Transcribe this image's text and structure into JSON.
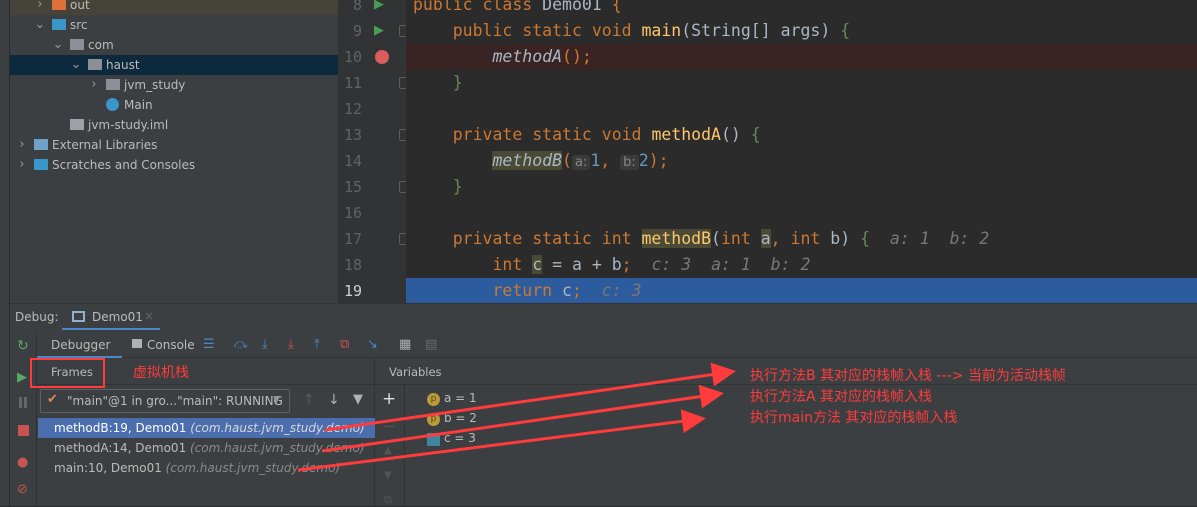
{
  "project_tree": [
    {
      "label": "out",
      "depth": 1,
      "expanded": false,
      "icon": "folder-orange-icon"
    },
    {
      "label": "src",
      "depth": 1,
      "expanded": true,
      "icon": "source-folder-icon"
    },
    {
      "label": "com",
      "depth": 2,
      "expanded": true,
      "icon": "package-icon"
    },
    {
      "label": "haust",
      "depth": 3,
      "expanded": true,
      "icon": "package-icon",
      "selected": true
    },
    {
      "label": "jvm_study",
      "depth": 4,
      "expanded": false,
      "icon": "package-icon"
    },
    {
      "label": "Main",
      "depth": 4,
      "icon": "java-class-icon"
    },
    {
      "label": "jvm-study.iml",
      "depth": 2,
      "icon": "iml-file-icon"
    },
    {
      "label": "External Libraries",
      "depth": 0,
      "expanded": false,
      "icon": "libraries-icon"
    },
    {
      "label": "Scratches and Consoles",
      "depth": 0,
      "expanded": false,
      "icon": "scratches-icon"
    }
  ],
  "editor": {
    "lines": [
      {
        "n": "8",
        "tokens": [
          [
            "kw",
            "public class "
          ],
          [
            "id",
            "Demo01 "
          ],
          [
            "br",
            "{"
          ]
        ]
      },
      {
        "n": "9",
        "tokens": [
          [
            "id",
            "    "
          ],
          [
            "kw",
            "public static void "
          ],
          [
            "fn",
            "main"
          ],
          [
            "id",
            "(String[] args) "
          ],
          [
            "grn",
            "{"
          ]
        ]
      },
      {
        "n": "10",
        "tokens": [
          [
            "id",
            "        "
          ],
          [
            "it",
            "methodA"
          ],
          [
            "br",
            "();"
          ]
        ]
      },
      {
        "n": "11",
        "tokens": [
          [
            "grn",
            "    }"
          ]
        ]
      },
      {
        "n": "12",
        "tokens": []
      },
      {
        "n": "13",
        "tokens": [
          [
            "id",
            "    "
          ],
          [
            "kw",
            "private static void "
          ],
          [
            "fn",
            "methodA"
          ],
          [
            "id",
            "() "
          ],
          [
            "grn",
            "{"
          ]
        ]
      },
      {
        "n": "14",
        "tokens": [
          [
            "id",
            "        "
          ],
          [
            "it hl",
            "methodB"
          ],
          [
            "br",
            "("
          ],
          [
            "ph",
            "a:"
          ],
          [
            "num",
            "1"
          ],
          [
            "br",
            ", "
          ],
          [
            "ph",
            "b:"
          ],
          [
            "num",
            "2"
          ],
          [
            "br",
            ");"
          ]
        ]
      },
      {
        "n": "15",
        "tokens": [
          [
            "grn",
            "    }"
          ]
        ]
      },
      {
        "n": "16",
        "tokens": []
      },
      {
        "n": "17",
        "tokens": [
          [
            "id",
            "    "
          ],
          [
            "kw",
            "private static int "
          ],
          [
            "fn hl",
            "methodB"
          ],
          [
            "id",
            "("
          ],
          [
            "kw",
            "int "
          ],
          [
            "id hl",
            "a"
          ],
          [
            "kw",
            ", int "
          ],
          [
            "id",
            "b) "
          ],
          [
            "grn",
            "{"
          ],
          [
            "hint",
            "  a: 1  b: 2"
          ]
        ]
      },
      {
        "n": "18",
        "tokens": [
          [
            "id",
            "        "
          ],
          [
            "kw",
            "int "
          ],
          [
            "id hl",
            "c"
          ],
          [
            "id",
            " = a + b"
          ],
          [
            "kw",
            ";"
          ],
          [
            "hint",
            "  c: 3  a: 1  b: 2"
          ]
        ]
      },
      {
        "n": "19",
        "tokens": [
          [
            "id",
            "        "
          ],
          [
            "kw",
            "return "
          ],
          [
            "id",
            "c"
          ],
          [
            "kw",
            ";"
          ],
          [
            "hint",
            "  c: 3"
          ]
        ]
      }
    ],
    "breakpoint_line": "10",
    "current_line": "19"
  },
  "debug": {
    "label": "Debug:",
    "session_tab": "Demo01",
    "tabs": {
      "debugger": "Debugger",
      "console": "Console"
    },
    "frames_header": "Frames",
    "thread_select": "\"main\"@1 in gro...\"main\": RUNNING",
    "frames": [
      {
        "method": "methodB:19, Demo01",
        "pkg": "(com.haust.jvm_study.demo)",
        "selected": true
      },
      {
        "method": "methodA:14, Demo01",
        "pkg": "(com.haust.jvm_study.demo)"
      },
      {
        "method": "main:10, Demo01",
        "pkg": "(com.haust.jvm_study.demo)"
      }
    ],
    "variables_header": "Variables",
    "variables": [
      {
        "text": "a = 1",
        "icon": "parameter-icon"
      },
      {
        "text": "b = 2",
        "icon": "parameter-icon"
      },
      {
        "text": "c = 3",
        "icon": "local-variable-icon"
      }
    ]
  },
  "annotations": {
    "frames_label": "虚拟机栈",
    "notes": [
      "执行方法B 其对应的栈帧入栈  ---> 当前为活动栈帧",
      "执行方法A 其对应的栈帧入栈",
      "执行main方法 其对应的栈帧入栈"
    ],
    "color": "#ff3b3b"
  }
}
